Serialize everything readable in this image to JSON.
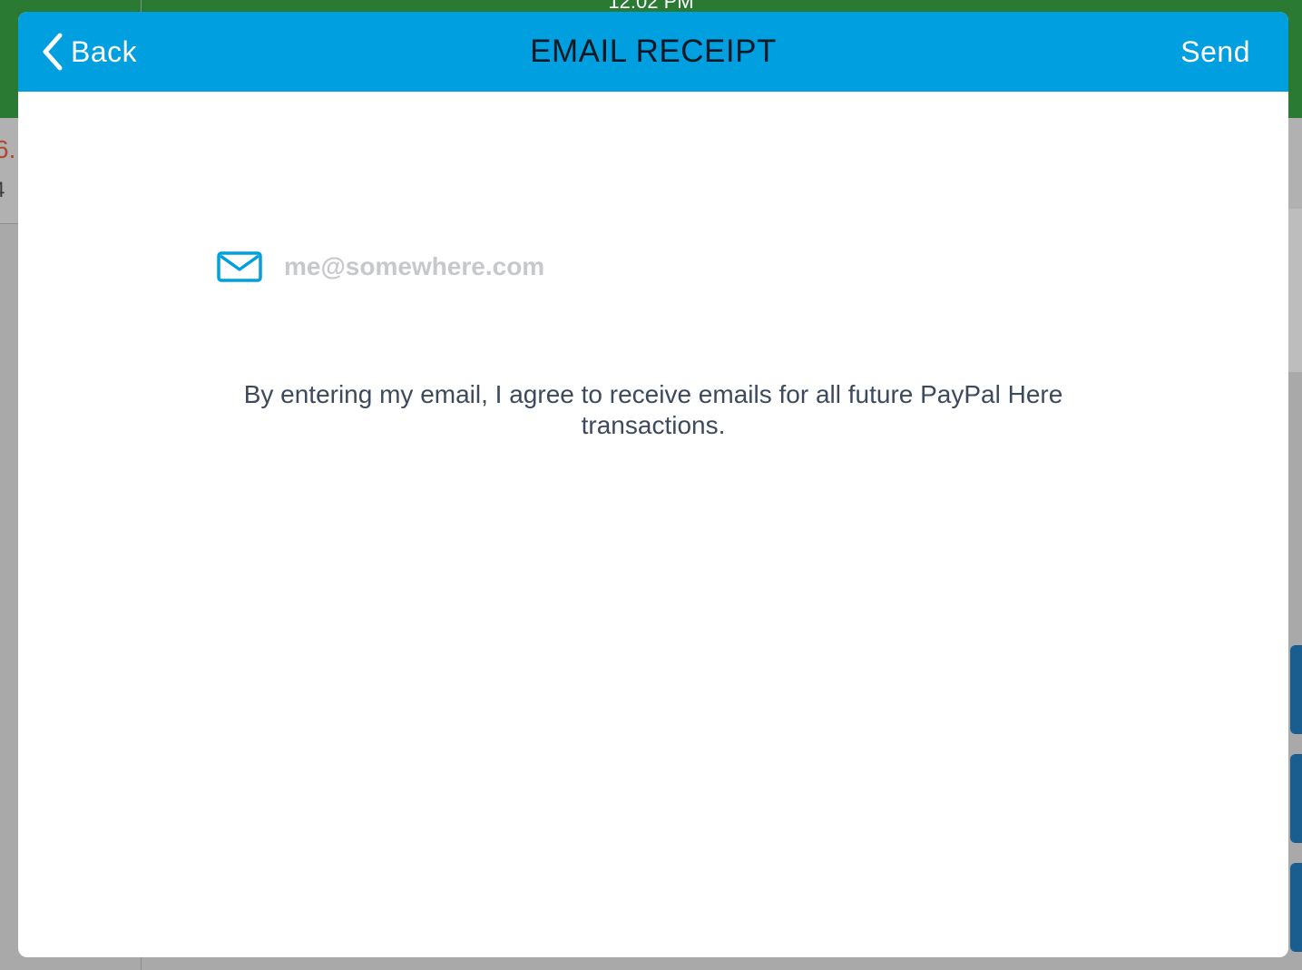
{
  "background": {
    "status_time": "12:02 PM",
    "left_price_fragment": "6.",
    "left_sub_fragment": "4"
  },
  "colors": {
    "header_blue": "#009fe0",
    "background_green": "#2a7a33",
    "placeholder_gray": "#c6c8cc",
    "body_text": "#3c4a5c"
  },
  "header": {
    "back_label": "Back",
    "title": "EMAIL RECEIPT",
    "send_label": "Send"
  },
  "icons": {
    "back": "chevron-left-icon",
    "mail": "mail-icon"
  },
  "email": {
    "value": "",
    "placeholder": "me@somewhere.com"
  },
  "consent": {
    "text": "By entering my email, I agree to receive emails for all future PayPal Here transactions."
  }
}
